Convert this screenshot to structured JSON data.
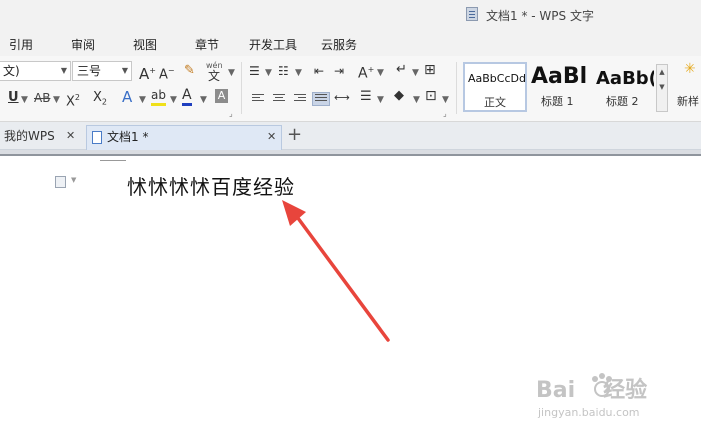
{
  "window": {
    "title": "文档1 * - WPS 文字"
  },
  "menu": {
    "items": [
      "引用",
      "审阅",
      "视图",
      "章节",
      "开发工具",
      "云服务"
    ]
  },
  "ribbon": {
    "font_name": "文)",
    "font_size": "三号",
    "grow_font": "A",
    "shrink_font": "A",
    "pinyin_top": "wén",
    "pinyin_bottom": "文",
    "underline": "U",
    "strikethrough": "AB",
    "superscript": "X",
    "subscript": "X",
    "font_color": "A",
    "char_shade": "A",
    "styles": [
      {
        "preview": "AaBbCcDd",
        "label": "正文"
      },
      {
        "preview": "AaBl",
        "label": "标题 1"
      },
      {
        "preview": "AaBb(",
        "label": "标题 2"
      }
    ],
    "new_style_label": "新样"
  },
  "tabs": [
    {
      "label": "我的WPS"
    },
    {
      "label": "文档1 *"
    }
  ],
  "document": {
    "text": "怵怵怵怵百度经验"
  },
  "watermark": {
    "logo_left": "Bai",
    "logo_right": "经验",
    "sub": "jingyan.baidu.com"
  },
  "colors": {
    "arrow": "#e8453c",
    "highlight": "#f0e01a",
    "font_color_bar": "#1f3fbf",
    "active_tab": "#dfe8f5"
  }
}
